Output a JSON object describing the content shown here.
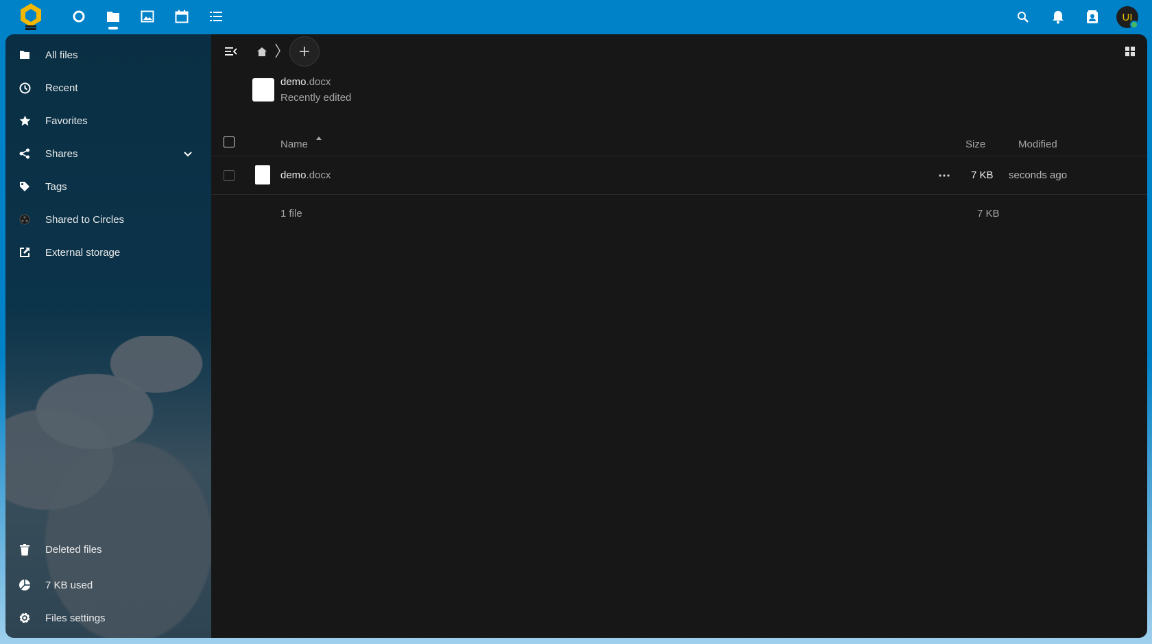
{
  "colors": {
    "header_bg": "#0082c9",
    "main_bg": "#171717",
    "sidebar_bg": "#0b3349",
    "avatar_initials_color": "#e6c000",
    "status_online": "#46ba61"
  },
  "header": {
    "apps": [
      {
        "name": "Dashboard",
        "icon": "circle-icon"
      },
      {
        "name": "Files",
        "icon": "folder-icon",
        "active": true
      },
      {
        "name": "Photos",
        "icon": "image-icon"
      },
      {
        "name": "Calendar",
        "icon": "calendar-icon"
      },
      {
        "name": "Tasks",
        "icon": "list-icon"
      }
    ],
    "right_icons": [
      "search-icon",
      "bell-icon",
      "contacts-icon"
    ],
    "avatar_initials": "UI"
  },
  "sidebar": {
    "items": [
      {
        "label": "All files",
        "icon": "folder-icon"
      },
      {
        "label": "Recent",
        "icon": "clock-icon"
      },
      {
        "label": "Favorites",
        "icon": "star-icon"
      },
      {
        "label": "Shares",
        "icon": "share-icon",
        "expandable": true
      },
      {
        "label": "Tags",
        "icon": "tag-icon"
      },
      {
        "label": "Shared to Circles",
        "icon": "circles-icon"
      },
      {
        "label": "External storage",
        "icon": "external-link-icon"
      }
    ],
    "footer": [
      {
        "label": "Deleted files",
        "icon": "trash-icon"
      },
      {
        "label": "7 KB used",
        "icon": "pie-chart-icon"
      },
      {
        "label": "Files settings",
        "icon": "gear-icon"
      }
    ]
  },
  "recent": {
    "name": "demo",
    "ext": ".docx",
    "subtitle": "Recently edited"
  },
  "table": {
    "columns": {
      "name": "Name",
      "size": "Size",
      "modified": "Modified"
    },
    "rows": [
      {
        "name": "demo",
        "ext": ".docx",
        "size": "7 KB",
        "modified": "seconds ago"
      }
    ],
    "summary": {
      "count": "1 file",
      "size": "7 KB"
    }
  }
}
